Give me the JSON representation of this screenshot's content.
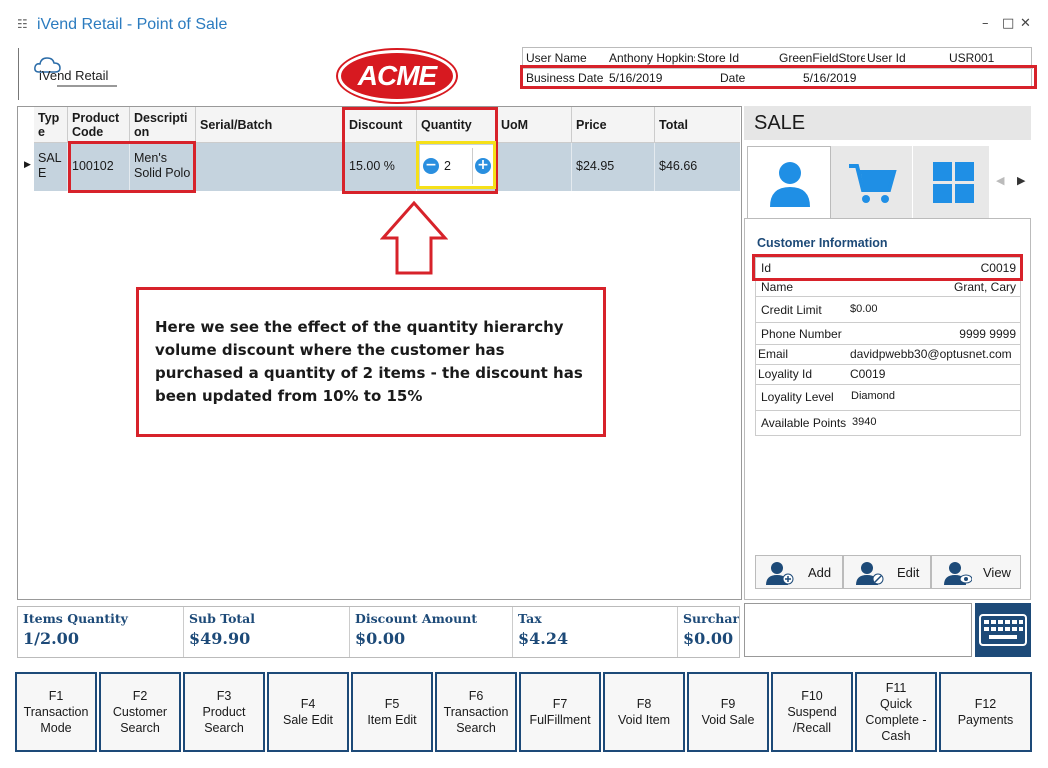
{
  "window": {
    "title": "iVend Retail - Point of Sale",
    "controls": [
      "–",
      "□",
      "✕"
    ]
  },
  "logo": {
    "text": "iVend Retail",
    "brand": "ACME"
  },
  "info": {
    "user_name_label": "User Name",
    "user_name": "Anthony Hopkins",
    "store_id_label": "Store Id",
    "store_id": "GreenFieldStore",
    "user_id_label": "User Id",
    "user_id": "USR001",
    "business_date_label": "Business Date",
    "business_date": "5/16/2019",
    "date_label": "Date",
    "date": "5/16/2019"
  },
  "grid": {
    "headers": {
      "type": "Typ\ne",
      "product_code": "Product\nCode",
      "description": "Descripti\non",
      "serial": "Serial/Batch",
      "discount": "Discount",
      "quantity": "Quantity",
      "uom": "UoM",
      "price": "Price",
      "total": "Total"
    },
    "row": {
      "type": "SAL\nE",
      "product_code": "100102",
      "description": "Men's\nSolid Polo",
      "serial": "",
      "discount": "15.00 %",
      "quantity": "2",
      "uom": "",
      "price": "$24.95",
      "total": "$46.66"
    }
  },
  "callout": "Here we see the effect of the quantity hierarchy volume discount where the customer has purchased a quantity of 2 items - the discount has been updated from 10% to 15%",
  "sale": {
    "header": "SALE",
    "customer_title": "Customer Information",
    "fields": [
      {
        "k": "Id",
        "v": "C0019"
      },
      {
        "k": "Name",
        "v": "Grant, Cary"
      },
      {
        "k": "Credit Limit",
        "v": "$0.00"
      },
      {
        "k": "Phone Number",
        "v": "9999 9999"
      },
      {
        "k": "Email",
        "v": "davidpwebb30@optusnet.com"
      },
      {
        "k": "Loyality Id",
        "v": "C0019"
      },
      {
        "k": "Loyality Level",
        "v": "Diamond"
      },
      {
        "k": "Available Points",
        "v": "3940"
      }
    ],
    "buttons": {
      "add": "Add",
      "edit": "Edit",
      "view": "View"
    }
  },
  "summary": {
    "items_label": "Items Quantity",
    "items": "1/2.00",
    "subtotal_label": "Sub Total",
    "subtotal": "$49.90",
    "discount_label": "Discount Amount",
    "discount": "$0.00",
    "tax_label": "Tax",
    "tax": "$4.24",
    "surcharge_label": "Surcharge",
    "surcharge": "$0.00"
  },
  "fkeys": [
    {
      "key": "F1",
      "label": "Transaction\nMode"
    },
    {
      "key": "F2",
      "label": "Customer\nSearch"
    },
    {
      "key": "F3",
      "label": "Product\nSearch"
    },
    {
      "key": "F4",
      "label": "Sale Edit"
    },
    {
      "key": "F5",
      "label": "Item Edit"
    },
    {
      "key": "F6",
      "label": "Transaction\nSearch"
    },
    {
      "key": "F7",
      "label": "FulFillment"
    },
    {
      "key": "F8",
      "label": "Void Item"
    },
    {
      "key": "F9",
      "label": "Void Sale"
    },
    {
      "key": "F10",
      "label": "Suspend\n/Recall"
    },
    {
      "key": "F11",
      "label": "Quick\nComplete -\nCash"
    },
    {
      "key": "F12",
      "label": "Payments"
    }
  ],
  "colors": {
    "accent": "#1d4a78",
    "highlight_red": "#d7222a",
    "highlight_yellow": "#f5e01a",
    "row_bg": "#c5d3de",
    "brand_red": "#d71920"
  }
}
